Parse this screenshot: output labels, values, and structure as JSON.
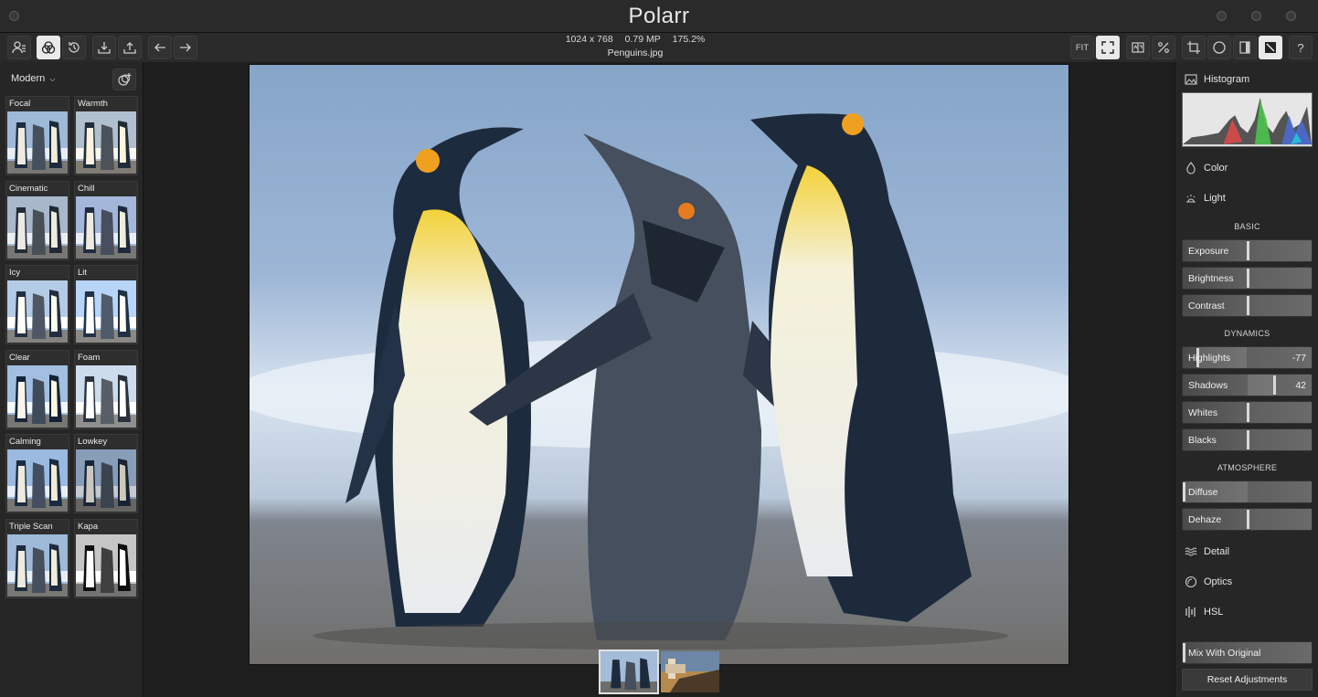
{
  "app": {
    "title": "Polarr"
  },
  "image_info": {
    "dimensions": "1024 x 768",
    "megapixels": "0.79 MP",
    "zoom": "175.2%",
    "filename": "Penguins.jpg"
  },
  "toolbar": {
    "fit_label": "FIT",
    "help_label": "?",
    "left_icons": [
      "user-card-icon",
      "filters-icon",
      "history-icon",
      "import-icon",
      "export-icon",
      "undo-icon",
      "redo-icon"
    ],
    "right_icons": [
      "fullscreen-icon",
      "compare-icon",
      "percent-icon",
      "crop-icon",
      "circle-mask-icon",
      "gradient-mask-icon",
      "brush-mask-icon"
    ]
  },
  "presets": {
    "group_label": "Modern",
    "items": [
      {
        "label": "Focal"
      },
      {
        "label": "Warmth"
      },
      {
        "label": "Cinematic"
      },
      {
        "label": "Chill"
      },
      {
        "label": "Icy"
      },
      {
        "label": "Lit"
      },
      {
        "label": "Clear"
      },
      {
        "label": "Foam"
      },
      {
        "label": "Calming"
      },
      {
        "label": "Lowkey"
      },
      {
        "label": "Triple Scan"
      },
      {
        "label": "Kapa"
      }
    ]
  },
  "right_panel": {
    "histogram_label": "Histogram",
    "color_label": "Color",
    "light_label": "Light",
    "basic_title": "BASIC",
    "basic": [
      {
        "label": "Exposure",
        "value": "",
        "level": 0
      },
      {
        "label": "Brightness",
        "value": "",
        "level": 0
      },
      {
        "label": "Contrast",
        "value": "",
        "level": 0
      }
    ],
    "dynamics_title": "DYNAMICS",
    "dynamics": [
      {
        "label": "Highlights",
        "value": "-77",
        "level": -77
      },
      {
        "label": "Shadows",
        "value": "42",
        "level": 42
      },
      {
        "label": "Whites",
        "value": "",
        "level": 0
      },
      {
        "label": "Blacks",
        "value": "",
        "level": 0
      }
    ],
    "atmosphere_title": "ATMOSPHERE",
    "atmosphere": [
      {
        "label": "Diffuse",
        "value": "",
        "level": -100
      },
      {
        "label": "Dehaze",
        "value": "",
        "level": 0
      }
    ],
    "detail_label": "Detail",
    "optics_label": "Optics",
    "hsl_label": "HSL",
    "mix_label": "Mix With Original",
    "reset_label": "Reset Adjustments"
  },
  "colors": {
    "accent": "#e9e9e9",
    "panel": "#262626",
    "background": "#1e1e1e"
  }
}
